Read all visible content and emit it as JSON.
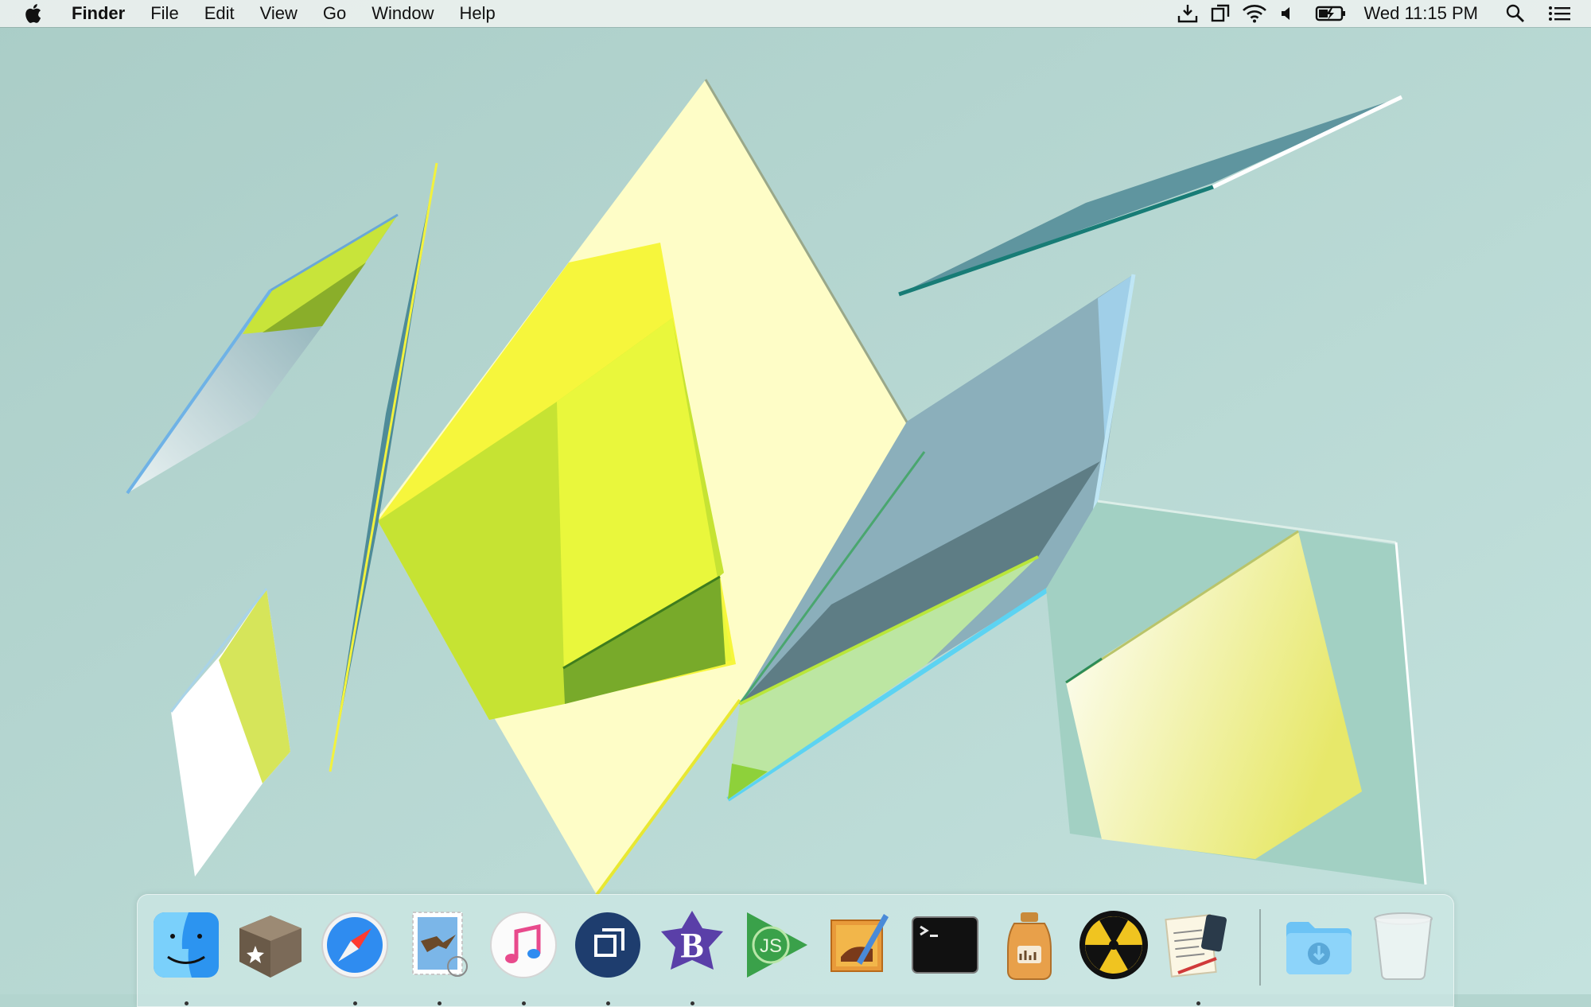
{
  "menubar": {
    "apple_icon": "apple-logo-icon",
    "app_name": "Finder",
    "menus": [
      "File",
      "Edit",
      "View",
      "Go",
      "Window",
      "Help"
    ],
    "status_icons": [
      "download-icon",
      "screen-mirror-icon",
      "wifi-icon",
      "volume-icon",
      "battery-charging-icon"
    ],
    "clock": "Wed 11:15 PM",
    "search_icon": "spotlight-search-icon",
    "notifications_icon": "notification-center-icon"
  },
  "dock": {
    "apps": [
      {
        "name": "finder-app",
        "running": true
      },
      {
        "name": "archive-box-app",
        "running": false
      },
      {
        "name": "safari-app",
        "running": true
      },
      {
        "name": "mail-app",
        "running": true
      },
      {
        "name": "music-app",
        "running": true
      },
      {
        "name": "screen-sharing-app",
        "running": true
      },
      {
        "name": "bbedit-app",
        "running": true
      },
      {
        "name": "javascript-app",
        "running": false
      },
      {
        "name": "preview-app",
        "running": false
      },
      {
        "name": "terminal-app",
        "running": false
      },
      {
        "name": "jar-app",
        "running": false
      },
      {
        "name": "radiation-app",
        "running": false
      },
      {
        "name": "notes-app",
        "running": true
      }
    ],
    "stacks": [
      {
        "name": "downloads-folder"
      },
      {
        "name": "trash"
      }
    ]
  },
  "colors": {
    "wallpaper": "#b3d5cf",
    "yellow": "#f5f54a",
    "pale_yellow": "#fdfbc4",
    "teal": "#5f8d98"
  }
}
